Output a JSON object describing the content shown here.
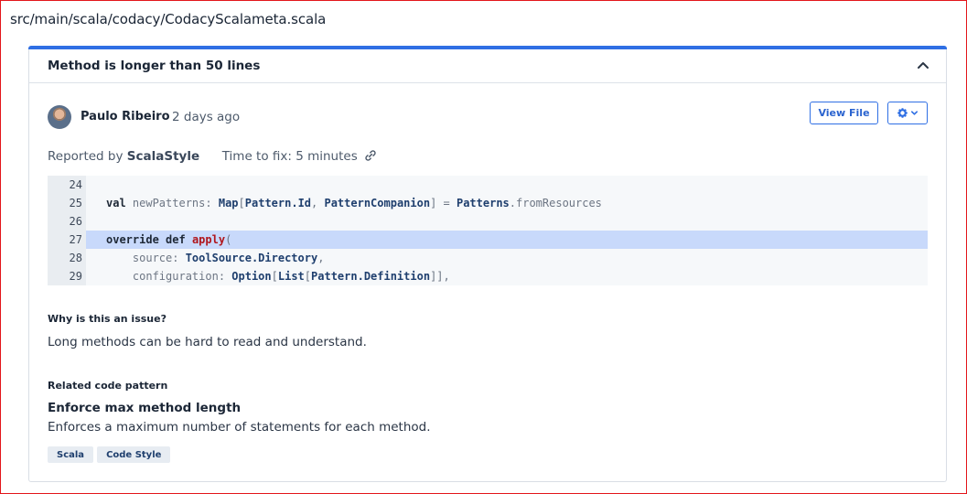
{
  "file_path": "src/main/scala/codacy/CodacyScalameta.scala",
  "issue": {
    "title": "Method is longer than 50 lines",
    "author": "Paulo Ribeiro",
    "time_ago": "2 days ago",
    "buttons": {
      "view_file": "View File"
    },
    "reported_by_label": "Reported by",
    "reporter": "ScalaStyle",
    "time_to_fix": "Time to fix: 5 minutes"
  },
  "code_lines": [
    {
      "n": "24",
      "text": "",
      "highlight": false
    },
    {
      "n": "25",
      "text": "val newPatterns: Map[Pattern.Id, PatternCompanion] = Patterns.fromResources",
      "highlight": false
    },
    {
      "n": "26",
      "text": "",
      "highlight": false
    },
    {
      "n": "27",
      "text": "override def apply(",
      "highlight": true
    },
    {
      "n": "28",
      "text": "    source: ToolSource.Directory,",
      "highlight": false
    },
    {
      "n": "29",
      "text": "    configuration: Option[List[Pattern.Definition]],",
      "highlight": false
    }
  ],
  "why": {
    "heading": "Why is this an issue?",
    "text": "Long methods can be hard to read and understand."
  },
  "related": {
    "heading": "Related code pattern",
    "pattern_title": "Enforce max method length",
    "pattern_desc": "Enforces a maximum number of statements for each method.",
    "tags": [
      "Scala",
      "Code Style"
    ]
  },
  "colors": {
    "accent": "#2f6fe4",
    "highlight_line": "#c8d9fb",
    "frame": "#e3161b"
  },
  "icons": [
    "chevron-up-icon",
    "gear-icon",
    "chevron-down-icon",
    "link-icon",
    "avatar"
  ]
}
